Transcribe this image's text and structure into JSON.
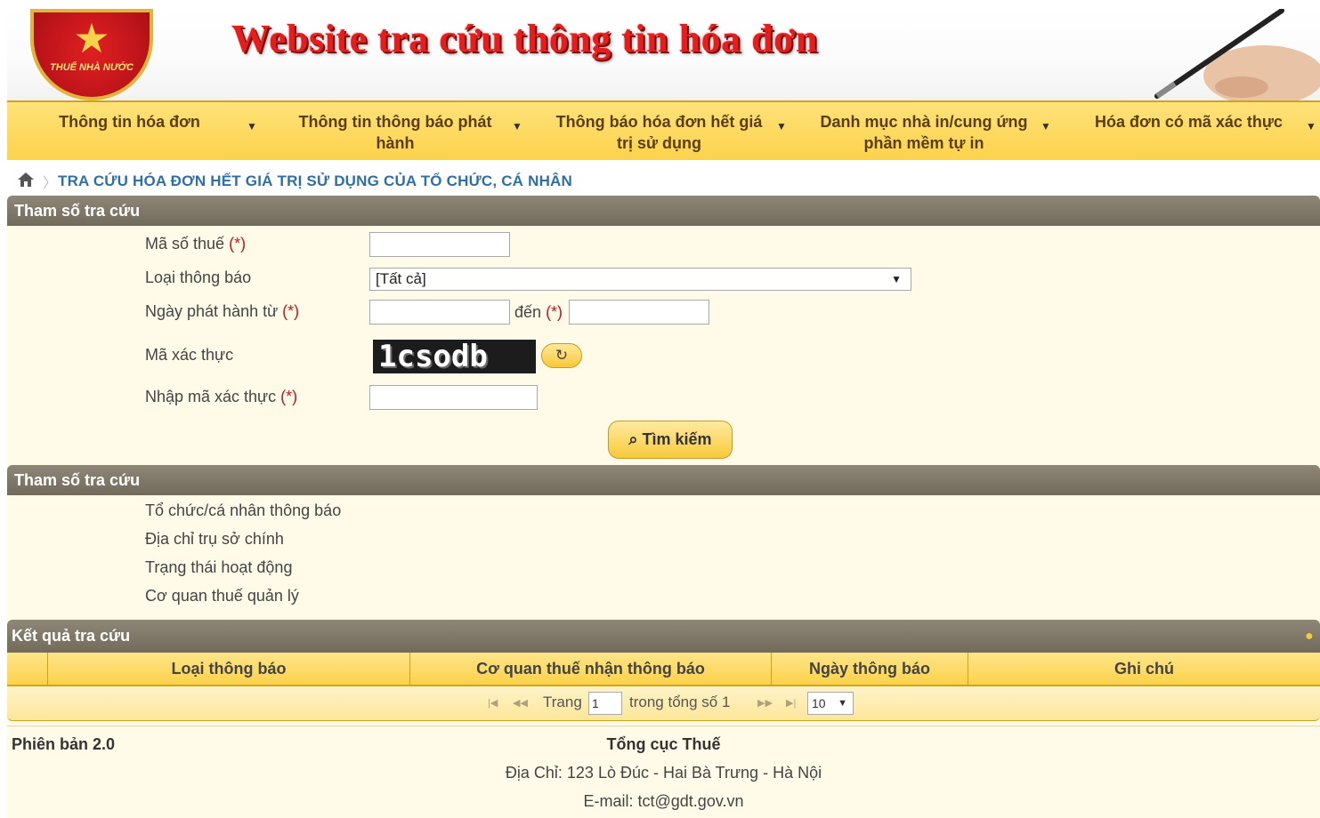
{
  "header": {
    "emblem_text": "THUẾ NHÀ NƯỚC",
    "title": "Website tra cứu thông tin hóa đơn"
  },
  "nav": {
    "items": [
      {
        "label": "Thông tin hóa đơn"
      },
      {
        "label": "Thông tin thông báo phát hành"
      },
      {
        "label": "Thông báo hóa đơn hết giá trị sử dụng"
      },
      {
        "label": "Danh mục nhà in/cung ứng phần mềm tự in"
      },
      {
        "label": "Hóa đơn có mã xác thực"
      }
    ]
  },
  "breadcrumb": {
    "text": "TRA CỨU HÓA ĐƠN HẾT GIÁ TRỊ SỬ DỤNG CỦA TỔ CHỨC, CÁ NHÂN"
  },
  "search_section": {
    "title": "Tham số tra cứu",
    "required_mark": "(*)",
    "tax_code_label": "Mã số thuế",
    "notice_type_label": "Loại thông báo",
    "notice_type_value": "[Tất cả]",
    "date_from_label": "Ngày phát hành từ",
    "date_to_label": "đến",
    "captcha_label": "Mã xác thực",
    "captcha_text": "1csodb",
    "captcha_input_label": "Nhập mã xác thực",
    "search_button": "Tìm kiếm"
  },
  "info_section": {
    "title": "Tham số tra cứu",
    "fields": [
      "Tổ chức/cá nhân thông báo",
      "Địa chỉ trụ sở chính",
      "Trạng thái hoạt động",
      "Cơ quan thuế quản lý"
    ]
  },
  "results": {
    "title": "Kết quả tra cứu",
    "columns": [
      "Loại thông báo",
      "Cơ quan thuế nhận thông báo",
      "Ngày thông báo",
      "Ghi chú"
    ],
    "pager": {
      "page_label": "Trang",
      "page_value": "1",
      "total_label": "trong tổng số 1",
      "page_size": "10"
    }
  },
  "footer": {
    "version": "Phiên bản 2.0",
    "org": "Tổng cục Thuế",
    "address": "Địa Chỉ: 123 Lò Đúc - Hai Bà Trưng - Hà Nội",
    "email": "E-mail: tct@gdt.gov.vn"
  }
}
